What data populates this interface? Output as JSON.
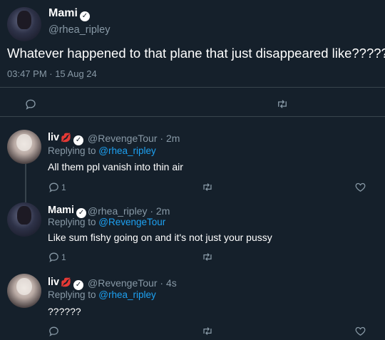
{
  "main_tweet": {
    "name": "Mami",
    "handle": "@rhea_ripley",
    "text": "Whatever happened to that plane that just disappeared like?????",
    "timestamp": "03:47 PM · 15 Aug 24"
  },
  "replies": [
    {
      "name": "liv",
      "handle": "@RevengeTour",
      "time": "· 2m",
      "replying_to_prefix": "Replying to ",
      "replying_to": "@rhea_ripley",
      "text": "All them ppl vanish into thin air",
      "reply_count": "1",
      "avatar": "liv"
    },
    {
      "name": "Mami",
      "handle": "@rhea_ripley",
      "time": "· 2m",
      "replying_to_prefix": "Replying to ",
      "replying_to": "@RevengeTour",
      "text": "Like sum fishy going on and it's not just your pussy",
      "reply_count": "1",
      "avatar": "mami"
    },
    {
      "name": "liv",
      "handle": "@RevengeTour",
      "time": "· 4s",
      "replying_to_prefix": "Replying to ",
      "replying_to": "@rhea_ripley",
      "text": "??????",
      "reply_count": "",
      "avatar": "liv"
    }
  ],
  "icons": {
    "reply": "reply-icon",
    "retweet": "retweet-icon",
    "like": "heart-icon",
    "verified": "verified-badge-icon",
    "lips": "lips-emoji-icon"
  },
  "colors": {
    "background": "#15202b",
    "text": "#ffffff",
    "secondary": "#8899a6",
    "link": "#1da1f2",
    "divider": "#38444d"
  }
}
